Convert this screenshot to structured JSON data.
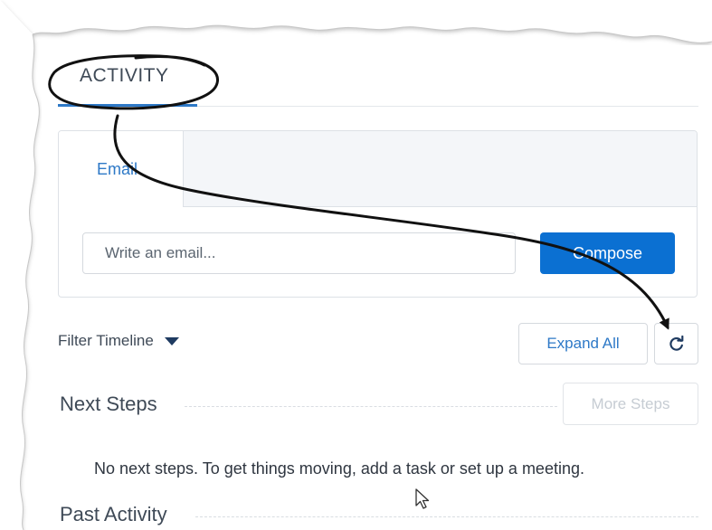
{
  "tabs": {
    "activity_label": "ACTIVITY"
  },
  "composer": {
    "email_tab_label": "Email",
    "input_placeholder": "Write an email...",
    "compose_label": "Compose"
  },
  "timeline": {
    "filter_label": "Filter Timeline",
    "expand_all_label": "Expand All",
    "refresh_icon": "refresh-icon"
  },
  "next_steps": {
    "title": "Next Steps",
    "more_steps_label": "More Steps",
    "empty_message": "No next steps. To get things moving, add a task or set up a meeting."
  },
  "past_activity": {
    "title": "Past Activity"
  },
  "colors": {
    "accent": "#0b70d2",
    "link": "#2e79c7",
    "text": "#3f4a57",
    "annotation": "#111111"
  }
}
